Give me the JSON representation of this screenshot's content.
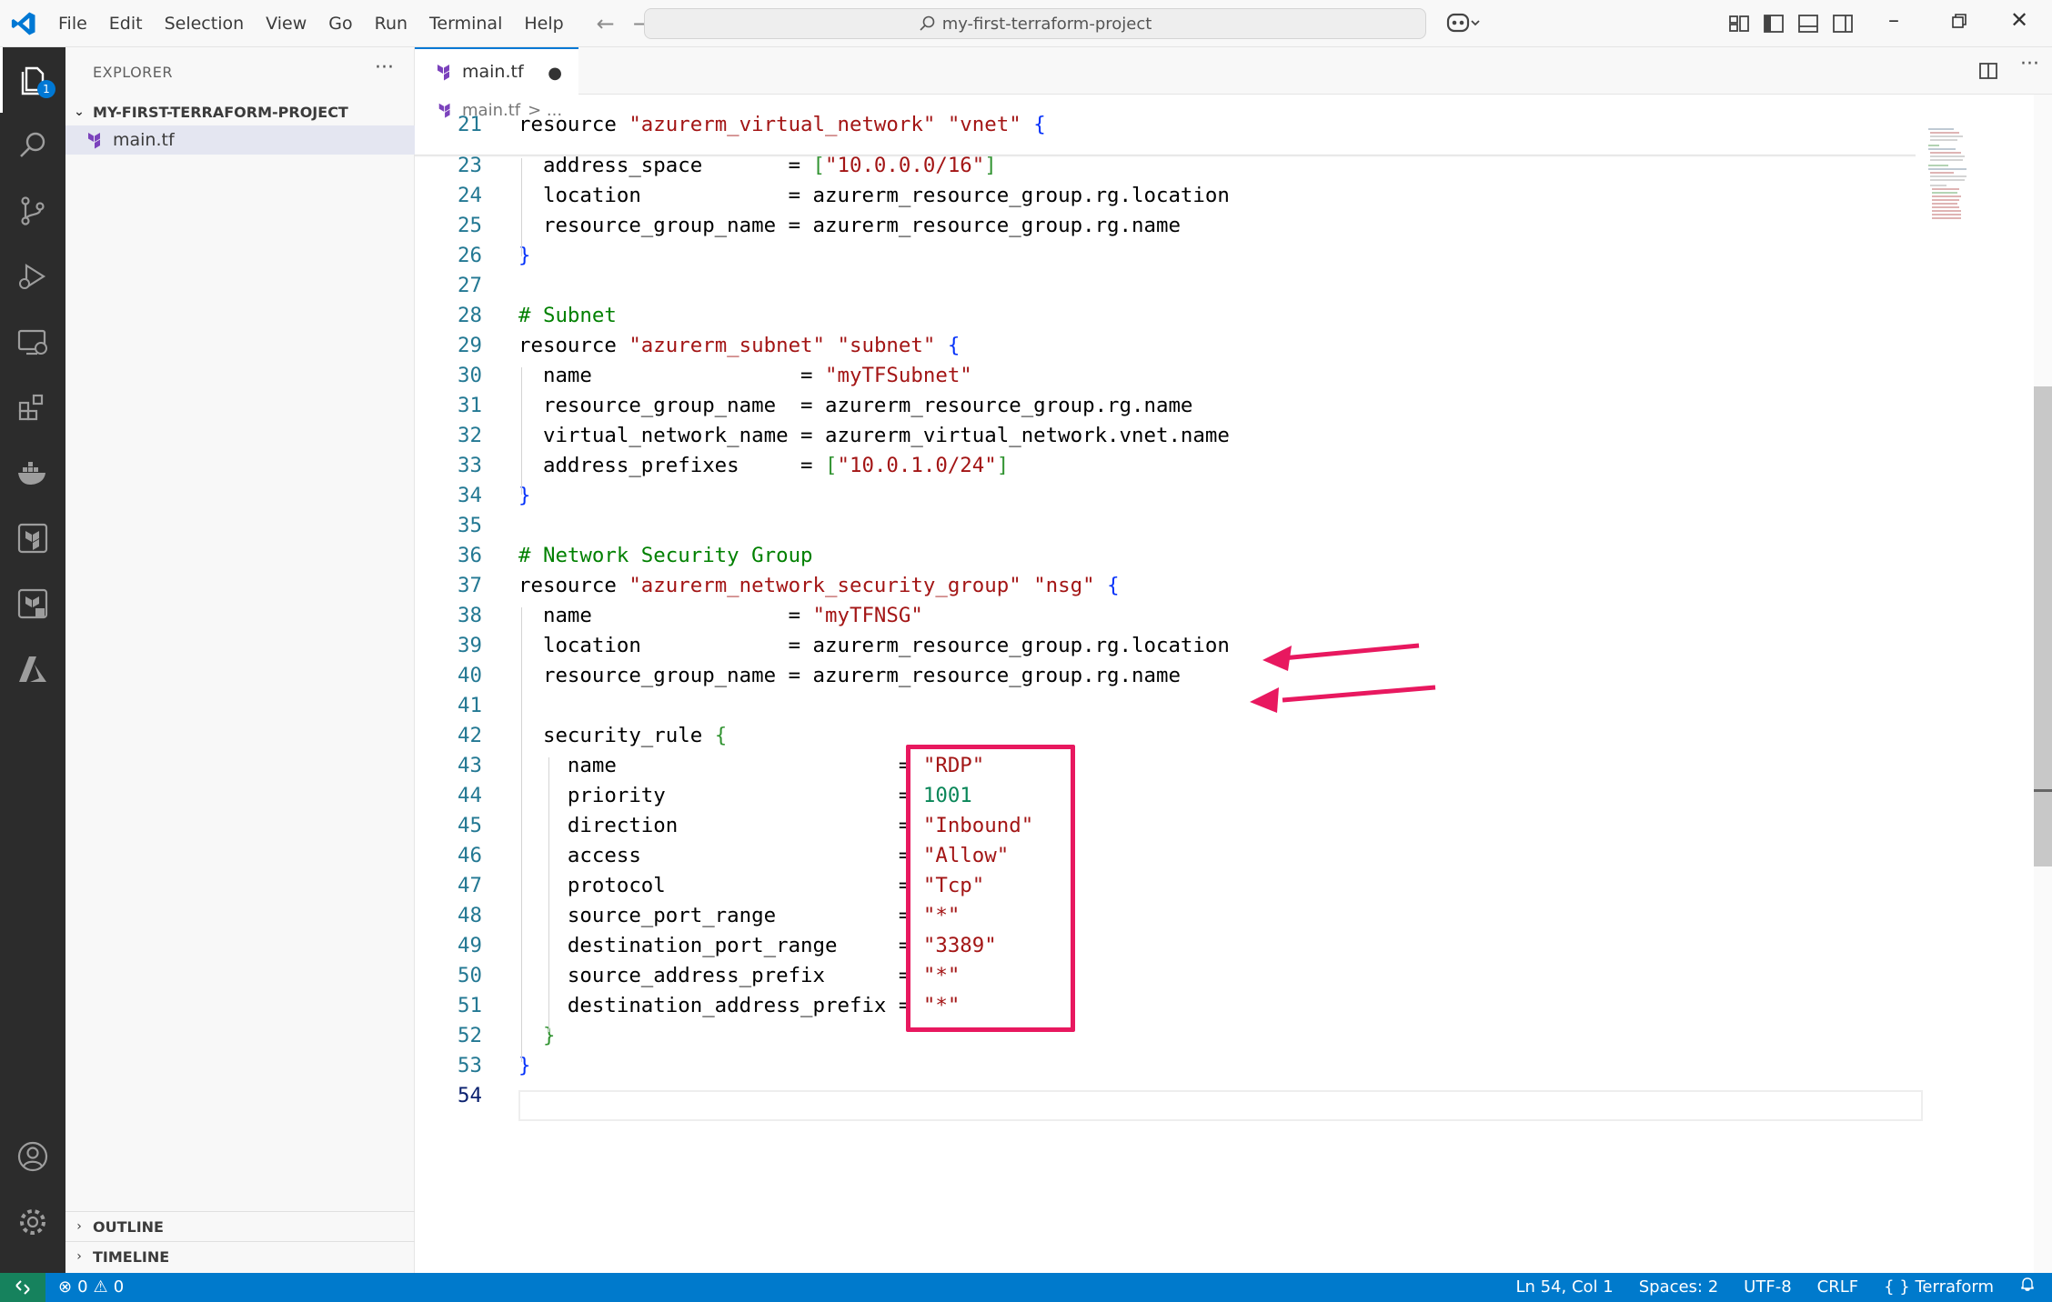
{
  "window": {
    "search_text": "my-first-terraform-project"
  },
  "menu": [
    "File",
    "Edit",
    "Selection",
    "View",
    "Go",
    "Run",
    "Terminal",
    "Help"
  ],
  "activity": {
    "explorer_badge": "1"
  },
  "sidebar": {
    "title": "EXPLORER",
    "more": "···",
    "project": "MY-FIRST-TERRAFORM-PROJECT",
    "file": "main.tf",
    "outline": "OUTLINE",
    "timeline": "TIMELINE"
  },
  "editor": {
    "tab_label": "main.tf",
    "dirty_marker": "●",
    "breadcrumb_file": "main.tf",
    "breadcrumb_rest": "> ...",
    "lines": [
      {
        "n": "21",
        "t": "resource \"azurerm_virtual_network\" \"vnet\" {"
      },
      {
        "n": "23",
        "t": "  address_space       = [\"10.0.0.0/16\"]"
      },
      {
        "n": "24",
        "t": "  location            = azurerm_resource_group.rg.location"
      },
      {
        "n": "25",
        "t": "  resource_group_name = azurerm_resource_group.rg.name"
      },
      {
        "n": "26",
        "t": "}"
      },
      {
        "n": "27",
        "t": ""
      },
      {
        "n": "28",
        "t": "# Subnet"
      },
      {
        "n": "29",
        "t": "resource \"azurerm_subnet\" \"subnet\" {"
      },
      {
        "n": "30",
        "t": "  name                 = \"myTFSubnet\""
      },
      {
        "n": "31",
        "t": "  resource_group_name  = azurerm_resource_group.rg.name"
      },
      {
        "n": "32",
        "t": "  virtual_network_name = azurerm_virtual_network.vnet.name"
      },
      {
        "n": "33",
        "t": "  address_prefixes     = [\"10.0.1.0/24\"]"
      },
      {
        "n": "34",
        "t": "}"
      },
      {
        "n": "35",
        "t": ""
      },
      {
        "n": "36",
        "t": "# Network Security Group"
      },
      {
        "n": "37",
        "t": "resource \"azurerm_network_security_group\" \"nsg\" {"
      },
      {
        "n": "38",
        "t": "  name                = \"myTFNSG\""
      },
      {
        "n": "39",
        "t": "  location            = azurerm_resource_group.rg.location"
      },
      {
        "n": "40",
        "t": "  resource_group_name = azurerm_resource_group.rg.name"
      },
      {
        "n": "41",
        "t": ""
      },
      {
        "n": "42",
        "t": "  security_rule {"
      },
      {
        "n": "43",
        "t": "    name                       = \"RDP\""
      },
      {
        "n": "44",
        "t": "    priority                   = 1001"
      },
      {
        "n": "45",
        "t": "    direction                  = \"Inbound\""
      },
      {
        "n": "46",
        "t": "    access                     = \"Allow\""
      },
      {
        "n": "47",
        "t": "    protocol                   = \"Tcp\""
      },
      {
        "n": "48",
        "t": "    source_port_range          = \"*\""
      },
      {
        "n": "49",
        "t": "    destination_port_range     = \"3389\""
      },
      {
        "n": "50",
        "t": "    source_address_prefix      = \"*\""
      },
      {
        "n": "51",
        "t": "    destination_address_prefix = \"*\""
      },
      {
        "n": "52",
        "t": "  }"
      },
      {
        "n": "53",
        "t": "}"
      },
      {
        "n": "54",
        "t": ""
      }
    ]
  },
  "status": {
    "errors": "0",
    "warnings": "0",
    "position": "Ln 54, Col 1",
    "spaces": "Spaces: 2",
    "encoding": "UTF-8",
    "eol": "CRLF",
    "language": "Terraform"
  },
  "colors": {
    "accent": "#0078d4",
    "statusbar": "#007acc",
    "annotation": "#e8185f",
    "keyword": "#0000ff",
    "string": "#a31515",
    "comment": "#008000",
    "number": "#098658"
  }
}
